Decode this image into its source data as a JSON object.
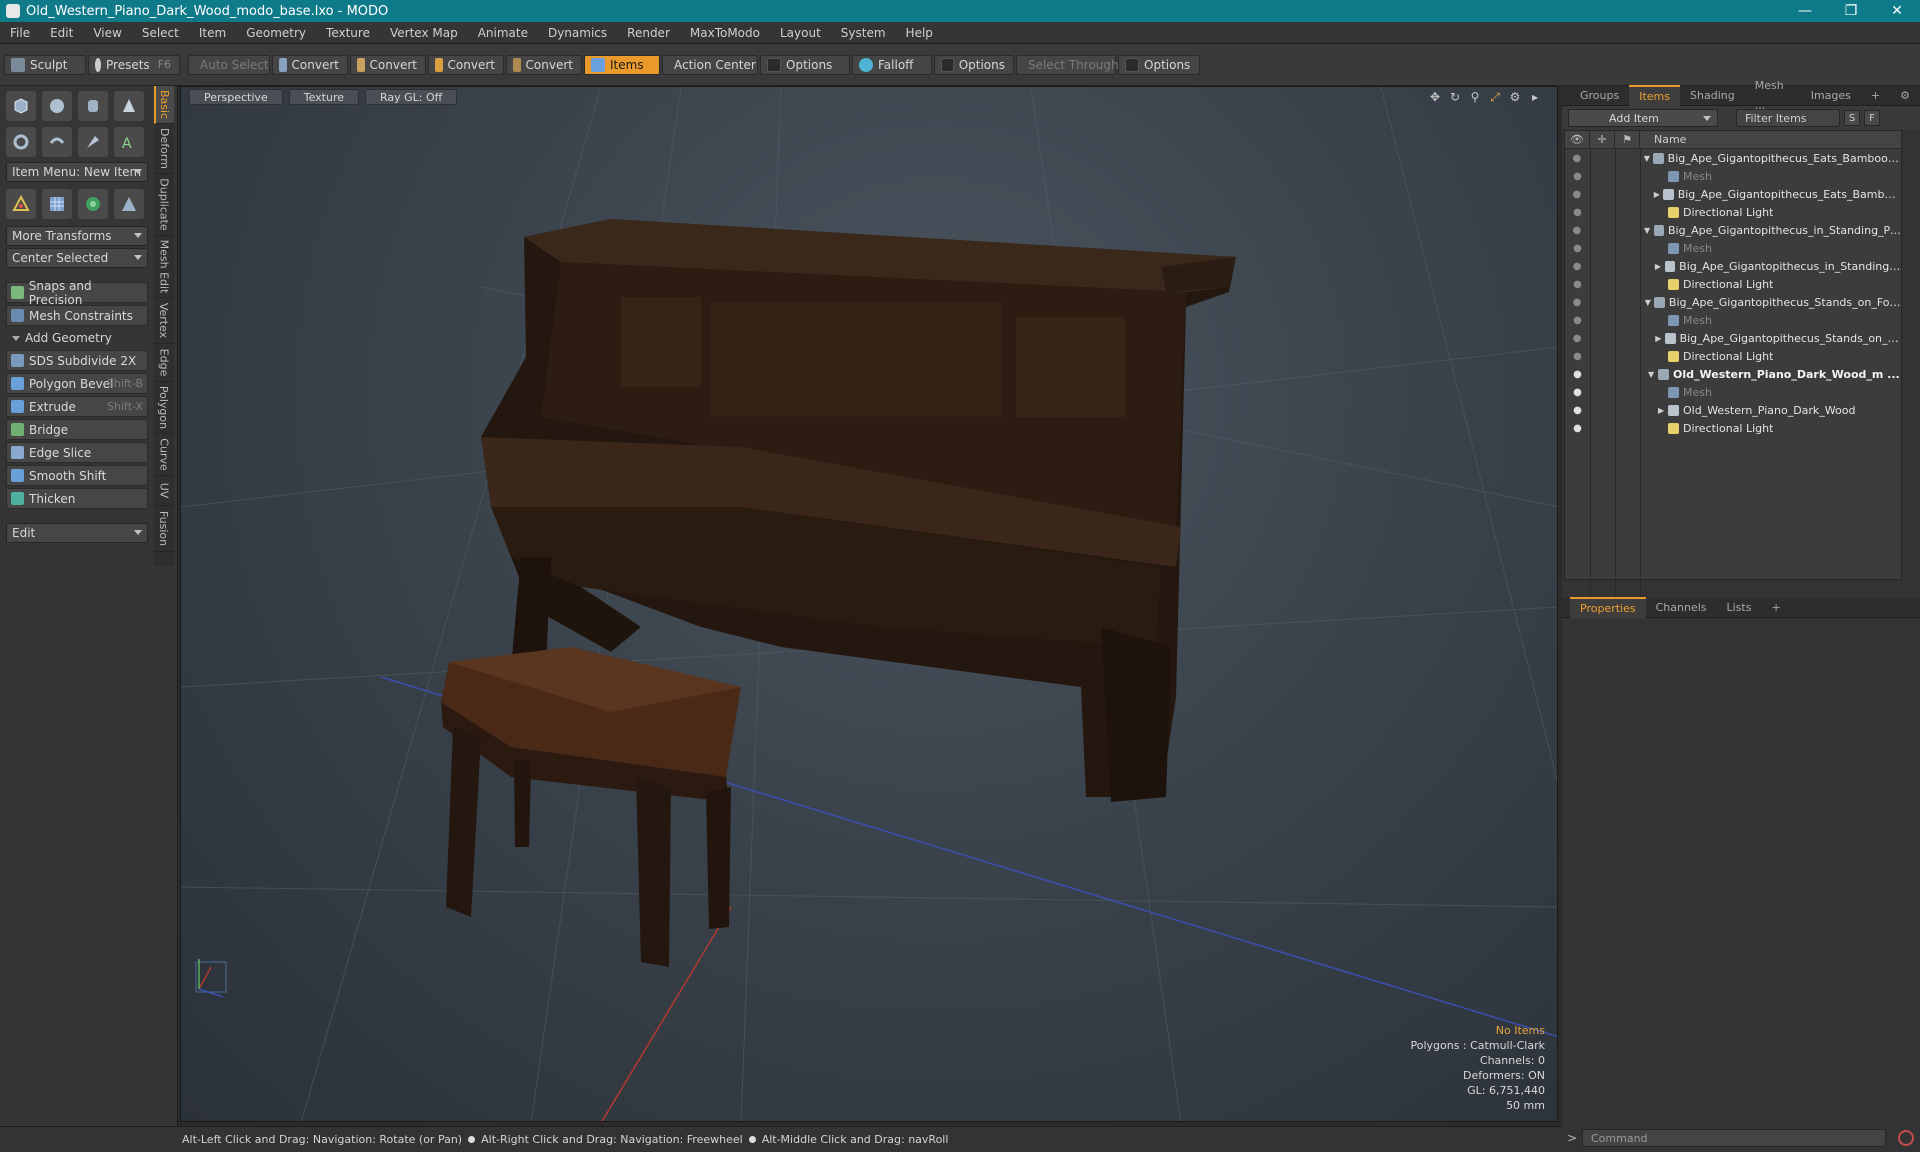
{
  "window": {
    "title": "Old_Western_Piano_Dark_Wood_modo_base.lxo - MODO",
    "minimize": "—",
    "maximize": "❐",
    "close": "✕"
  },
  "menu": [
    "File",
    "Edit",
    "View",
    "Select",
    "Item",
    "Geometry",
    "Texture",
    "Vertex Map",
    "Animate",
    "Dynamics",
    "Render",
    "MaxToModo",
    "Layout",
    "System",
    "Help"
  ],
  "toolbar": {
    "sculpt": "Sculpt",
    "presets": "Presets",
    "presets_hint": "F6",
    "auto_select": "Auto Select",
    "convert1": "Convert",
    "convert2": "Convert",
    "convert3": "Convert",
    "convert4": "Convert",
    "items": "Items",
    "action_center": "Action Center",
    "options1": "Options",
    "falloff": "Falloff",
    "options2": "Options",
    "select_through": "Select Through",
    "options3": "Options"
  },
  "left_panel": {
    "item_menu": "Item Menu: New Item",
    "more_transforms": "More Transforms",
    "center_selected": "Center Selected",
    "snaps": "Snaps and Precision",
    "mesh_constraints": "Mesh Constraints",
    "add_geometry": "Add Geometry",
    "tools": [
      {
        "label": "SDS Subdivide 2X",
        "shortcut": ""
      },
      {
        "label": "Polygon Bevel",
        "shortcut": "Shift-B"
      },
      {
        "label": "Extrude",
        "shortcut": "Shift-X"
      },
      {
        "label": "Bridge",
        "shortcut": ""
      },
      {
        "label": "Edge Slice",
        "shortcut": ""
      },
      {
        "label": "Smooth Shift",
        "shortcut": ""
      },
      {
        "label": "Thicken",
        "shortcut": ""
      }
    ],
    "edit_dropdown": "Edit",
    "vtabs": [
      "Basic",
      "Deform",
      "Duplicate",
      "Mesh Edit",
      "Vertex",
      "Edge",
      "Polygon",
      "Curve",
      "UV",
      "Fusion"
    ]
  },
  "viewport": {
    "tabs": [
      "Perspective",
      "Texture",
      "Ray GL: Off"
    ],
    "info": {
      "no_items": "No Items",
      "polygons": "Polygons : Catmull-Clark",
      "channels": "Channels: 0",
      "deformers": "Deformers: ON",
      "gl": "GL: 6,751,440",
      "size": "50 mm"
    },
    "colors": {
      "wood": "#2e1e14",
      "bench_top": "#4a2a17",
      "grid": "#5b6570",
      "axis_x": "#b03a30",
      "axis_z": "#3c4fb0"
    }
  },
  "right_panel": {
    "top_tabs": [
      "Groups",
      "Items",
      "Shading",
      "Mesh ...",
      "Images"
    ],
    "add_item": "Add Item",
    "filter_items": "Filter Items",
    "btn_s": "S",
    "btn_f": "F",
    "tree_header": "Name",
    "tree": [
      {
        "label": "Big_Ape_Gigantopithecus_Eats_Bamboo_Pl...",
        "level": 0,
        "type": "scene",
        "expander": "▼",
        "visible": false
      },
      {
        "label": "Mesh",
        "level": 1,
        "type": "mesh",
        "expander": "",
        "visible": false,
        "dim": true
      },
      {
        "label": "Big_Ape_Gigantopithecus_Eats_Bamboo ...",
        "level": 1,
        "type": "group",
        "expander": "▶",
        "visible": false
      },
      {
        "label": "Directional Light",
        "level": 1,
        "type": "light",
        "expander": "",
        "visible": false
      },
      {
        "label": "Big_Ape_Gigantopithecus_in_Standing_Pos...",
        "level": 0,
        "type": "scene",
        "expander": "▼",
        "visible": false
      },
      {
        "label": "Mesh",
        "level": 1,
        "type": "mesh",
        "expander": "",
        "visible": false,
        "dim": true
      },
      {
        "label": "Big_Ape_Gigantopithecus_in_Standing_ ...",
        "level": 1,
        "type": "group",
        "expander": "▶",
        "visible": false
      },
      {
        "label": "Directional Light",
        "level": 1,
        "type": "light",
        "expander": "",
        "visible": false
      },
      {
        "label": "Big_Ape_Gigantopithecus_Stands_on_Four...",
        "level": 0,
        "type": "scene",
        "expander": "▼",
        "visible": false
      },
      {
        "label": "Mesh",
        "level": 1,
        "type": "mesh",
        "expander": "",
        "visible": false,
        "dim": true
      },
      {
        "label": "Big_Ape_Gigantopithecus_Stands_on_F ...",
        "level": 1,
        "type": "group",
        "expander": "▶",
        "visible": false
      },
      {
        "label": "Directional Light",
        "level": 1,
        "type": "light",
        "expander": "",
        "visible": false
      },
      {
        "label": "Old_Western_Piano_Dark_Wood_m ...",
        "level": 0,
        "type": "scene",
        "expander": "▼",
        "visible": true,
        "bold": true
      },
      {
        "label": "Mesh",
        "level": 1,
        "type": "mesh",
        "expander": "",
        "visible": true,
        "dim": true
      },
      {
        "label": "Old_Western_Piano_Dark_Wood",
        "level": 1,
        "type": "group",
        "expander": "▶",
        "visible": true
      },
      {
        "label": "Directional Light",
        "level": 1,
        "type": "light",
        "expander": "",
        "visible": true
      }
    ],
    "bottom_tabs": [
      "Properties",
      "Channels",
      "Lists"
    ],
    "command_placeholder": "Command",
    "command_prompt": ">"
  },
  "statusbar": {
    "hint1": "Alt-Left Click and Drag: Navigation: Rotate (or Pan)",
    "hint2": "Alt-Right Click and Drag: Navigation: Freewheel",
    "hint3": "Alt-Middle Click and Drag: navRoll"
  }
}
